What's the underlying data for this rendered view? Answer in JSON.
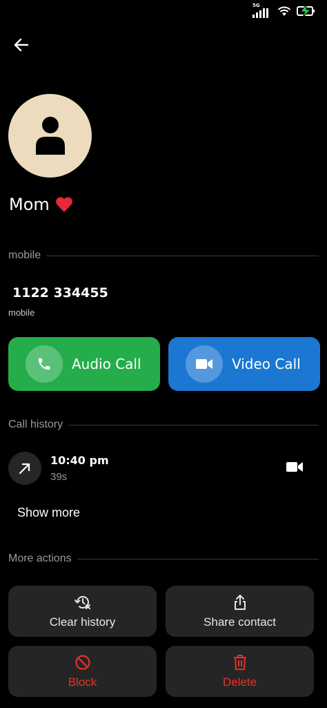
{
  "status_bar": {
    "network": "5G",
    "icons": [
      "signal-icon",
      "wifi-icon",
      "battery-charging-icon"
    ],
    "battery_color": "#2bd94f"
  },
  "header": {
    "back_icon": "back-arrow-icon"
  },
  "contact": {
    "name": "Mom",
    "emoji": "❤️",
    "avatar_color": "#ecdcbd"
  },
  "sections": {
    "mobile_label": "mobile",
    "call_history_label": "Call history",
    "more_actions_label": "More actions"
  },
  "phone": {
    "number": "1122 334455",
    "type": "mobile"
  },
  "call_buttons": {
    "audio": {
      "label": "Audio Call",
      "color": "#25ad4c",
      "icon": "phone-icon"
    },
    "video": {
      "label": "Video Call",
      "color": "#1b77d2",
      "icon": "video-camera-icon"
    }
  },
  "call_history": [
    {
      "direction": "outgoing",
      "time": "10:40 pm",
      "duration": "39s",
      "type": "video"
    }
  ],
  "show_more_label": "Show more",
  "actions": {
    "clear_history": "Clear history",
    "share_contact": "Share contact",
    "block": "Block",
    "delete": "Delete",
    "danger_color": "#e5322b"
  }
}
